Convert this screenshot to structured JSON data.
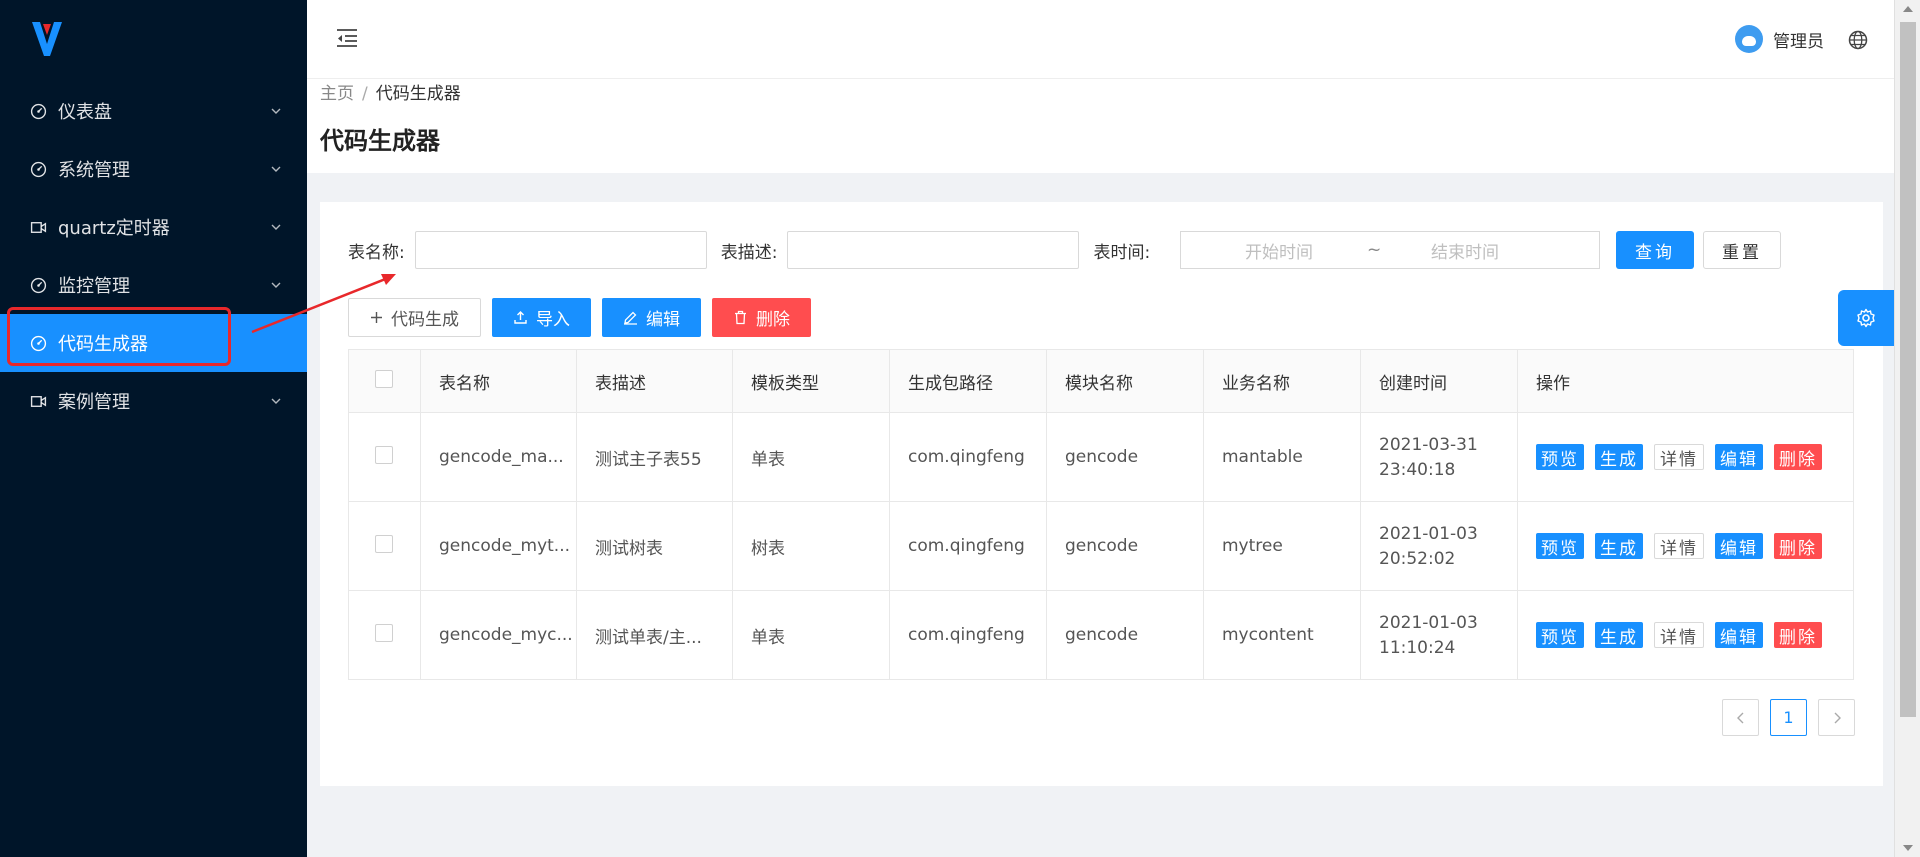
{
  "sidebar": {
    "items": [
      {
        "label": "仪表盘",
        "icon": "dashboard-icon"
      },
      {
        "label": "系统管理",
        "icon": "dashboard-icon"
      },
      {
        "label": "quartz定时器",
        "icon": "video-camera-icon"
      },
      {
        "label": "监控管理",
        "icon": "dashboard-icon"
      },
      {
        "label": "代码生成器",
        "icon": "dashboard-icon"
      },
      {
        "label": "案例管理",
        "icon": "video-camera-icon"
      }
    ]
  },
  "header": {
    "username": "管理员"
  },
  "breadcrumb": {
    "home": "主页",
    "separator": "/",
    "current": "代码生成器"
  },
  "page_title": "代码生成器",
  "search": {
    "table_name_label": "表名称:",
    "table_name_value": "",
    "table_desc_label": "表描述:",
    "table_desc_value": "",
    "table_time_label": "表时间:",
    "start_placeholder": "开始时间",
    "range_separator": "~",
    "end_placeholder": "结束时间",
    "query_label": "查询",
    "reset_label": "重置"
  },
  "toolbar": {
    "generate_label": "代码生成",
    "import_label": "导入",
    "edit_label": "编辑",
    "delete_label": "删除"
  },
  "table": {
    "columns": [
      "表名称",
      "表描述",
      "模板类型",
      "生成包路径",
      "模块名称",
      "业务名称",
      "创建时间",
      "操作"
    ],
    "rows": [
      {
        "name": "gencode_ma...",
        "desc": "测试主子表55",
        "template": "单表",
        "package": "com.qingfeng",
        "module": "gencode",
        "business": "mantable",
        "date": "2021-03-31",
        "time": "23:40:18"
      },
      {
        "name": "gencode_myt...",
        "desc": "测试树表",
        "template": "树表",
        "package": "com.qingfeng",
        "module": "gencode",
        "business": "mytree",
        "date": "2021-01-03",
        "time": "20:52:02"
      },
      {
        "name": "gencode_myc...",
        "desc": "测试单表/主...",
        "template": "单表",
        "package": "com.qingfeng",
        "module": "gencode",
        "business": "mycontent",
        "date": "2021-01-03",
        "time": "11:10:24"
      }
    ],
    "actions": {
      "preview": "预览",
      "generate": "生成",
      "detail": "详情",
      "edit": "编辑",
      "delete": "删除"
    }
  },
  "pagination": {
    "current_page": "1"
  },
  "colors": {
    "sidebar_bg": "#001529",
    "primary": "#1890ff",
    "danger": "#ff4d4f",
    "highlight": "#e8282b"
  }
}
